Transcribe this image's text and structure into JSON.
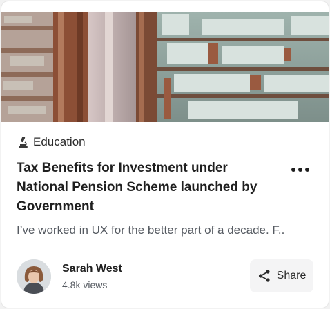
{
  "card": {
    "category": {
      "label": "Education",
      "icon": "microscope-icon"
    },
    "title": "Tax Benefits for Investment under National Pension Scheme launched by Government",
    "excerpt": "I’ve worked in UX for the better part of a decade. F..",
    "author": {
      "name": "Sarah West",
      "views": "4.8k views"
    },
    "share_label": "Share",
    "more_icon": "more-horizontal-icon",
    "share_icon": "share-icon"
  },
  "colors": {
    "title": "#1f1f1f",
    "muted_text": "#555a61",
    "share_bg": "#f4f4f5"
  }
}
